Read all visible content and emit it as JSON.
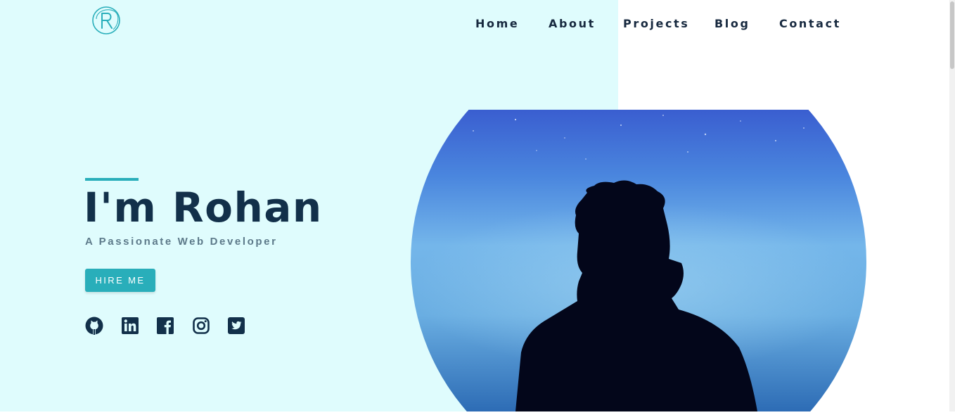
{
  "brand": {
    "logo_icon": "r-monogram-icon",
    "accent_color": "#29aeba",
    "text_color": "#12304a"
  },
  "nav": {
    "items": [
      {
        "label": "Home"
      },
      {
        "label": "About"
      },
      {
        "label": "Projects"
      },
      {
        "label": "Blog"
      },
      {
        "label": "Contact"
      }
    ]
  },
  "hero": {
    "title": "I'm Rohan",
    "subtitle": "A Passionate Web Developer",
    "cta_label": "HIRE ME",
    "socials": [
      "github-icon",
      "linkedin-icon",
      "facebook-icon",
      "instagram-icon",
      "twitter-icon"
    ],
    "photo": "portrait-silhouette-night-sky-image"
  },
  "colors": {
    "left_panel_bg": "#dffcfd",
    "page_bg": "#ffffff"
  }
}
